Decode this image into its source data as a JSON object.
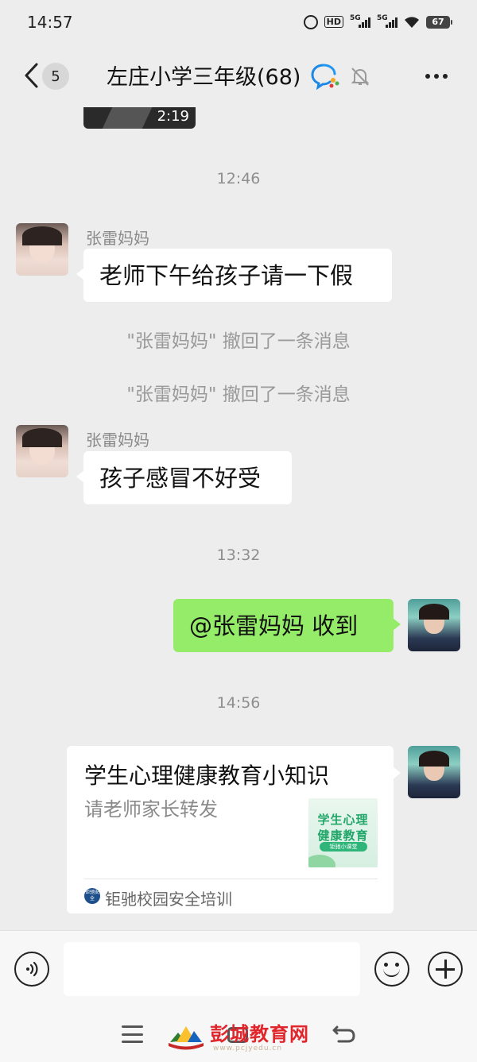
{
  "status_bar": {
    "time": "14:57",
    "hd_label": "HD",
    "signal1_label": "5G",
    "signal2_label": "5G",
    "battery": "67"
  },
  "header": {
    "back_count": "5",
    "title": "左庄小学三年级(68)",
    "icons": [
      "back-arrow-icon",
      "wecom-icon",
      "mute-bell-icon",
      "more-icon"
    ]
  },
  "messages": {
    "video_duration": "2:19",
    "time_1": "12:46",
    "sender_1": "张雷妈妈",
    "text_1": "老师下午给孩子请一下假",
    "recall_1": "\"张雷妈妈\" 撤回了一条消息",
    "recall_2": "\"张雷妈妈\" 撤回了一条消息",
    "sender_2": "张雷妈妈",
    "text_2": "孩子感冒不好受",
    "time_2": "13:32",
    "reply_text": "@张雷妈妈  收到",
    "time_3": "14:56"
  },
  "link_card": {
    "title": "学生心理健康教育小知识",
    "description": "请老师家长转发",
    "thumb_line1": "学生心理",
    "thumb_line2": "健康教育",
    "thumb_tag": "钜驰小课堂",
    "source_icon_text": "钜驰安全",
    "source_name": "钜驰校园安全培训"
  },
  "input_bar": {
    "placeholder": ""
  },
  "watermark": {
    "text": "彭城教育网",
    "sub": "www.pcjyedu.cn"
  },
  "colors": {
    "outgoing_bubble": "#95ec69",
    "incoming_bubble": "#ffffff",
    "background": "#ededed"
  }
}
